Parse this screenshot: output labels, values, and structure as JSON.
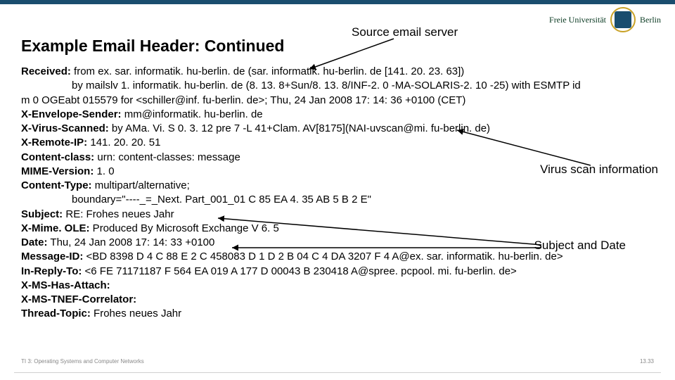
{
  "logo": {
    "name_part1": "Freie Universität",
    "name_part2": "Berlin"
  },
  "title": "Example Email Header: Continued",
  "annotations": {
    "source": "Source email server",
    "virus": "Virus scan information",
    "subject_date": "Subject and Date"
  },
  "headers": [
    {
      "label": "Received:",
      "value": " from ex. sar. informatik. hu-berlin. de (sar. informatik. hu-berlin. de [141. 20. 23. 63])",
      "indent": false
    },
    {
      "label": "",
      "value": "by mailslv 1. informatik. hu-berlin. de (8. 13. 8+Sun/8. 13. 8/INF-2. 0 -MA-SOLARIS-2. 10 -25) with ESMTP id",
      "indent": true
    },
    {
      "label": "",
      "value": "m 0 OGEabt 015579 for <schiller@inf. fu-berlin. de>; Thu, 24 Jan 2008 17: 14: 36 +0100 (CET)",
      "indent": false
    },
    {
      "label": "X-Envelope-Sender:",
      "value": " mm@informatik. hu-berlin. de",
      "indent": false
    },
    {
      "label": "X-Virus-Scanned:",
      "value": " by AMa. Vi. S 0. 3. 12 pre 7 -L 41+Clam. AV[8175](NAI-uvscan@mi. fu-berlin. de)",
      "indent": false
    },
    {
      "label": "X-Remote-IP:",
      "value": " 141. 20. 20. 51",
      "indent": false
    },
    {
      "label": "Content-class:",
      "value": " urn: content-classes: message",
      "indent": false
    },
    {
      "label": "MIME-Version:",
      "value": " 1. 0",
      "indent": false
    },
    {
      "label": "Content-Type:",
      "value": " multipart/alternative;",
      "indent": false
    },
    {
      "label": "",
      "value": "boundary=\"----_=_Next. Part_001_01 C 85 EA 4. 35 AB 5 B 2 E\"",
      "indent": true
    },
    {
      "label": "Subject:",
      "value": " RE: Frohes neues Jahr",
      "indent": false
    },
    {
      "label": "X-Mime. OLE:",
      "value": " Produced By Microsoft Exchange V 6. 5",
      "indent": false
    },
    {
      "label": "Date:",
      "value": " Thu, 24 Jan 2008 17: 14: 33 +0100",
      "indent": false
    },
    {
      "label": "Message-ID:",
      "value": " <BD 8398 D 4 C 88 E 2 C 458083 D 1 D 2 B 04 C 4 DA 3207 F 4 A@ex. sar. informatik. hu-berlin. de>",
      "indent": false
    },
    {
      "label": "In-Reply-To:",
      "value": " <6 FE 71171187 F 564 EA 019 A 177 D 00043 B 230418 A@spree. pcpool. mi. fu-berlin. de>",
      "indent": false
    },
    {
      "label": "X-MS-Has-Attach:",
      "value": "",
      "indent": false
    },
    {
      "label": "X-MS-TNEF-Correlator:",
      "value": "",
      "indent": false
    },
    {
      "label": "Thread-Topic:",
      "value": " Frohes neues Jahr",
      "indent": false
    }
  ],
  "footer": {
    "left": "TI 3: Operating Systems and Computer Networks",
    "right": "13.33"
  }
}
